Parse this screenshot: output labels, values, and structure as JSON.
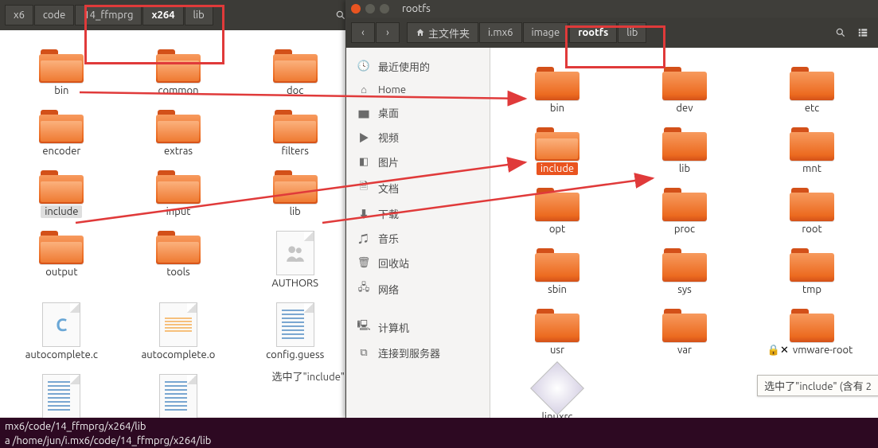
{
  "left_window": {
    "breadcrumbs": [
      "x6",
      "code",
      "14_ffmprg",
      "x264",
      "lib"
    ],
    "bold_index": 3,
    "folders_row1": [
      {
        "label": "bin",
        "open": true
      },
      {
        "label": "common",
        "open": true
      },
      {
        "label": "doc",
        "open": true
      }
    ],
    "folders_row2": [
      {
        "label": "encoder",
        "open": true
      },
      {
        "label": "extras",
        "open": true
      },
      {
        "label": "filters",
        "open": true
      }
    ],
    "folders_row3": [
      {
        "label": "include",
        "open": true,
        "selected": "grey"
      },
      {
        "label": "input",
        "open": true
      },
      {
        "label": "lib",
        "open": true
      }
    ],
    "row4": [
      {
        "label": "output",
        "type": "folder"
      },
      {
        "label": "tools",
        "type": "folder"
      },
      {
        "label": "AUTHORS",
        "type": "authors"
      }
    ],
    "row5": [
      {
        "label": "autocomplete.c",
        "type": "code"
      },
      {
        "label": "autocomplete.o",
        "type": "obj"
      },
      {
        "label": "config.guess",
        "type": "txt"
      }
    ],
    "row6": [
      {
        "label": "",
        "type": "txt"
      },
      {
        "label": "",
        "type": "txt"
      },
      {
        "label": "",
        "type": "blank"
      }
    ],
    "status": "选中了\"include\" ("
  },
  "right_window": {
    "title": "rootfs",
    "nav_home": "主文件夹",
    "breadcrumbs": [
      "i.mx6",
      "image",
      "rootfs",
      "lib"
    ],
    "bold_index": 2,
    "sidebar": [
      {
        "icon": "clock",
        "label": "最近使用的"
      },
      {
        "icon": "home",
        "label": "Home"
      },
      {
        "icon": "folder",
        "label": "桌面"
      },
      {
        "icon": "video",
        "label": "视频"
      },
      {
        "icon": "image",
        "label": "图片"
      },
      {
        "icon": "doc",
        "label": "文档"
      },
      {
        "icon": "download",
        "label": "下载"
      },
      {
        "icon": "music",
        "label": "音乐"
      },
      {
        "icon": "trash",
        "label": "回收站"
      },
      {
        "icon": "net",
        "label": "网络"
      },
      {
        "icon": "computer",
        "label": "计算机"
      },
      {
        "icon": "server",
        "label": "连接到服务器"
      }
    ],
    "grid": [
      [
        {
          "label": "bin"
        },
        {
          "label": "dev"
        },
        {
          "label": "etc"
        }
      ],
      [
        {
          "label": "include",
          "open": true,
          "selected": "orange"
        },
        {
          "label": "lib"
        },
        {
          "label": "mnt"
        }
      ],
      [
        {
          "label": "opt"
        },
        {
          "label": "proc"
        },
        {
          "label": "root"
        }
      ],
      [
        {
          "label": "sbin"
        },
        {
          "label": "sys"
        },
        {
          "label": "tmp"
        }
      ],
      [
        {
          "label": "usr"
        },
        {
          "label": "var"
        },
        {
          "label": "vmware-root",
          "vm": true
        }
      ]
    ],
    "last": {
      "label": "linuxrc"
    },
    "status": "选中了\"include\" (含有 2"
  },
  "terminal": {
    "line1": "mx6/code/14_ffmprg/x264/lib",
    "line2": "a /home/jun/i.mx6/code/14_ffmprg/x264/lib"
  }
}
